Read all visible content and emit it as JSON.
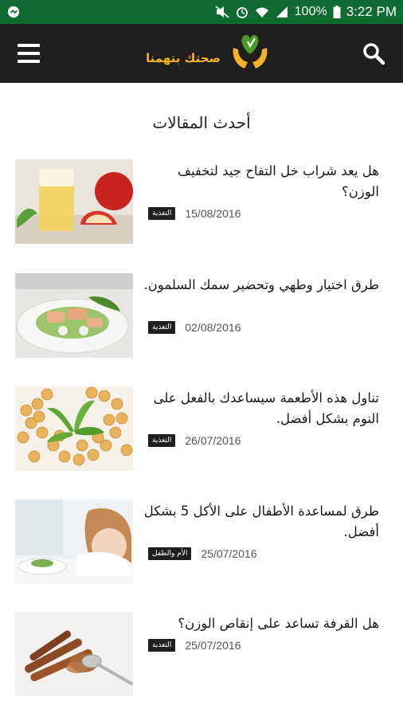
{
  "status_bar": {
    "battery": "100%",
    "time": "3:22 PM"
  },
  "app_bar": {
    "logo_text": "صحتك بتهمنا"
  },
  "section_title": "أحدث المقالات",
  "articles": [
    {
      "title": "هل يعد شراب خل التفاح جيد لتخفيف الوزن؟",
      "category": "التغذية",
      "date": "15/08/2016",
      "image": "apple-vinegar"
    },
    {
      "title": "طرق اختيار وطهي وتحضير سمك السلمون.",
      "category": "التغذية",
      "date": "02/08/2016",
      "image": "salmon-dish"
    },
    {
      "title": "تناول هذه الأطعمة سيساعدك بالفعل على النوم بشكل أفضل.",
      "category": "التغذية",
      "date": "26/07/2016",
      "image": "chickpeas"
    },
    {
      "title": "طرق لمساعدة الأطفال على الأكل 5 بشكل أفضل.",
      "category": "الأم والطفل",
      "date": "25/07/2016",
      "image": "child-eating"
    },
    {
      "title": "هل القرفة تساعد على إنقاص الوزن؟",
      "category": "التغذية",
      "date": "25/07/2016",
      "image": "cinnamon"
    }
  ],
  "colors": {
    "status_bar": "#0f6b2f",
    "app_bar": "#1f1f1f",
    "logo_gold": "#f5b323",
    "logo_green": "#4a9a2a"
  }
}
